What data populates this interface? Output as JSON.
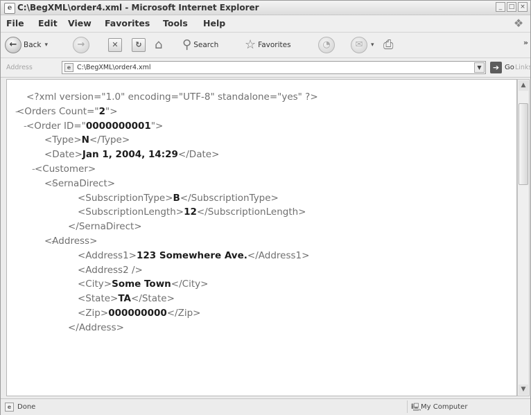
{
  "window": {
    "title": "C:\\BegXML\\order4.xml - Microsoft Internet Explorer",
    "controls": {
      "minimize": "_",
      "maximize": "□",
      "close": "×"
    }
  },
  "menu": [
    "File",
    "Edit",
    "View",
    "Favorites",
    "Tools",
    "Help"
  ],
  "toolbar": {
    "back": "Back",
    "search": "Search",
    "favorites": "Favorites"
  },
  "address": {
    "label": "Address",
    "value": "C:\\BegXML\\order4.xml",
    "go": "Go",
    "links": "Links"
  },
  "document": {
    "lines": [
      {
        "prefix": "",
        "segments": [
          {
            "text": "<?xml version=\"1.0\" encoding=\"UTF-8\" standalone=\"yes\" ?>",
            "style": "t"
          }
        ]
      },
      {
        "prefix": "-",
        "segments": [
          {
            "text": "<Orders Count=\"",
            "style": "t"
          },
          {
            "text": "2",
            "style": "b"
          },
          {
            "text": "\">",
            "style": "t"
          }
        ]
      },
      {
        "prefix": "-",
        "segments": [
          {
            "text": "<Order ID=\"",
            "style": "t"
          },
          {
            "text": "0000000001",
            "style": "b"
          },
          {
            "text": "\">",
            "style": "t"
          }
        ]
      },
      {
        "prefix": "",
        "segments": [
          {
            "text": "<Type>",
            "style": "t"
          },
          {
            "text": "N",
            "style": "b"
          },
          {
            "text": "</Type>",
            "style": "t"
          }
        ]
      },
      {
        "prefix": "",
        "segments": [
          {
            "text": "<Date>",
            "style": "t"
          },
          {
            "text": "Jan 1, 2004, 14:29",
            "style": "b"
          },
          {
            "text": "</Date>",
            "style": "t"
          }
        ]
      },
      {
        "prefix": "-",
        "segments": [
          {
            "text": "<Customer>",
            "style": "t"
          }
        ]
      },
      {
        "prefix": "-",
        "segments": [
          {
            "text": "<SernaDirect>",
            "style": "t"
          }
        ]
      },
      {
        "prefix": "",
        "segments": [
          {
            "text": "<SubscriptionType>",
            "style": "t"
          },
          {
            "text": "B",
            "style": "b"
          },
          {
            "text": "</SubscriptionType>",
            "style": "t"
          }
        ]
      },
      {
        "prefix": "",
        "segments": [
          {
            "text": "<SubscriptionLength>",
            "style": "t"
          },
          {
            "text": "12",
            "style": "b"
          },
          {
            "text": "</SubscriptionLength>",
            "style": "t"
          }
        ]
      },
      {
        "prefix": "",
        "segments": [
          {
            "text": "</SernaDirect>",
            "style": "t"
          }
        ]
      },
      {
        "prefix": "-",
        "segments": [
          {
            "text": "<Address>",
            "style": "t"
          }
        ]
      },
      {
        "prefix": "",
        "segments": [
          {
            "text": "<Address1>",
            "style": "t"
          },
          {
            "text": "123 Somewhere Ave.",
            "style": "b"
          },
          {
            "text": "</Address1>",
            "style": "t"
          }
        ]
      },
      {
        "prefix": "",
        "segments": [
          {
            "text": "<Address2 />",
            "style": "t"
          }
        ]
      },
      {
        "prefix": "",
        "segments": [
          {
            "text": "<City>",
            "style": "t"
          },
          {
            "text": "Some Town",
            "style": "b"
          },
          {
            "text": "</City>",
            "style": "t"
          }
        ]
      },
      {
        "prefix": "",
        "segments": [
          {
            "text": "<State>",
            "style": "t"
          },
          {
            "text": "TA",
            "style": "b"
          },
          {
            "text": "</State>",
            "style": "t"
          }
        ]
      },
      {
        "prefix": "",
        "segments": [
          {
            "text": "<Zip>",
            "style": "t"
          },
          {
            "text": "000000000",
            "style": "b"
          },
          {
            "text": "</Zip>",
            "style": "t"
          }
        ]
      },
      {
        "prefix": "",
        "segments": [
          {
            "text": "</Address>",
            "style": "t"
          }
        ]
      }
    ]
  },
  "status": {
    "text": "Done",
    "zone": "My Computer"
  },
  "colors": {
    "markup": "#6f6f6f",
    "value": "#1c1c1c"
  },
  "icons": [
    "ie-logo-icon",
    "back-arrow-icon",
    "forward-arrow-icon",
    "stop-icon",
    "refresh-icon",
    "home-icon",
    "search-icon",
    "favorites-star-icon",
    "history-icon",
    "mail-icon",
    "print-icon",
    "go-arrow-icon",
    "page-icon",
    "computer-icon"
  ]
}
